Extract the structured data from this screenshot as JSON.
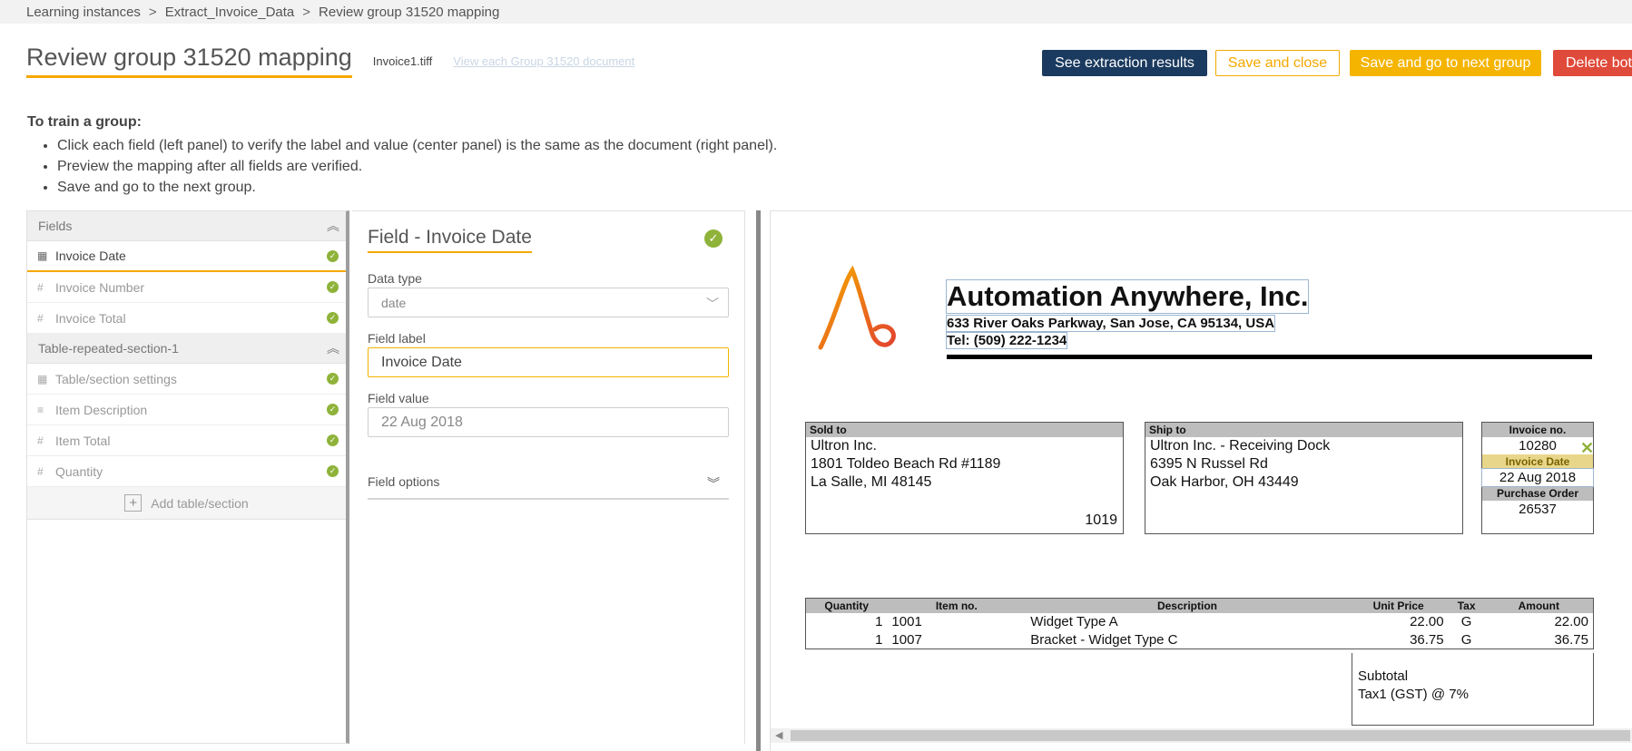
{
  "breadcrumb": {
    "items": [
      "Learning instances",
      "Extract_Invoice_Data",
      "Review group 31520 mapping"
    ],
    "separator": ">"
  },
  "header": {
    "title": "Review group 31520 mapping",
    "file_name": "Invoice1.tiff",
    "view_link": "View each Group 31520 document"
  },
  "actions": {
    "see_results": "See extraction results",
    "save_close": "Save and close",
    "save_next": "Save and go to next group",
    "delete": "Delete bot"
  },
  "instructions": {
    "heading": "To train a group:",
    "steps": [
      "Click each field (left panel) to verify the label and value (center panel) is the same as the document (right panel).",
      "Preview the mapping after all fields are verified.",
      "Save and go to the next group."
    ]
  },
  "left_panel": {
    "fields_header": "Fields",
    "fields": [
      {
        "name": "Invoice Date",
        "icon": "calendar-icon",
        "glyph": "▦"
      },
      {
        "name": "Invoice Number",
        "icon": "hash-icon",
        "glyph": "#"
      },
      {
        "name": "Invoice Total",
        "icon": "hash-icon",
        "glyph": "#"
      }
    ],
    "table_header": "Table-repeated-section-1",
    "table_fields": [
      {
        "name": "Table/section settings",
        "icon": "table-icon",
        "glyph": "▦"
      },
      {
        "name": "Item Description",
        "icon": "text-lines-icon",
        "glyph": "≡"
      },
      {
        "name": "Item Total",
        "icon": "hash-icon",
        "glyph": "#"
      },
      {
        "name": "Quantity",
        "icon": "hash-icon",
        "glyph": "#"
      }
    ],
    "add_table": "Add table/section"
  },
  "center_panel": {
    "title": "Field - Invoice Date",
    "data_type_label": "Data type",
    "data_type_value": "date",
    "field_label_label": "Field label",
    "field_label_value": "Invoice Date",
    "field_value_label": "Field value",
    "field_value_value": "22 Aug 2018",
    "field_options": "Field options"
  },
  "document": {
    "company": "Automation Anywhere, Inc.",
    "address": "633 River Oaks Parkway, San Jose, CA 95134, USA",
    "tel": "Tel: (509) 222-1234",
    "sold_to": {
      "header": "Sold to",
      "lines": [
        "Ultron Inc.",
        "1801 Toldeo Beach Rd #1189",
        "La Salle, MI 48145"
      ],
      "code": "1019"
    },
    "ship_to": {
      "header": "Ship to",
      "lines": [
        "Ultron Inc. - Receiving Dock",
        "6395 N Russel Rd",
        "Oak Harbor, OH 43449"
      ]
    },
    "invoice_info": {
      "invoice_no_label": "Invoice no.",
      "invoice_no": "10280",
      "invoice_date_label": "Invoice Date",
      "invoice_date": "22 Aug 2018",
      "po_label": "Purchase Order",
      "po": "26537",
      "remove_glyph": "✕"
    },
    "items_table": {
      "columns": [
        "Quantity",
        "Item no.",
        "Description",
        "Unit Price",
        "Tax",
        "Amount"
      ],
      "rows": [
        [
          "1",
          "1001",
          "Widget Type A",
          "22.00",
          "G",
          "22.00"
        ],
        [
          "1",
          "1007",
          "Bracket - Widget Type C",
          "36.75",
          "G",
          "36.75"
        ]
      ]
    },
    "subtotal_label": "Subtotal",
    "tax_label": "Tax1 (GST) @ 7%"
  },
  "colors": {
    "accent": "#f5a800",
    "primary": "#1b3a5f",
    "danger": "#e04a3a",
    "success": "#8fb33a"
  }
}
